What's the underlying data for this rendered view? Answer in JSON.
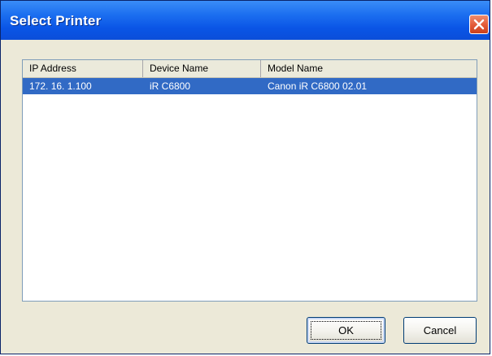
{
  "window": {
    "title": "Select Printer",
    "close_icon": "close-icon"
  },
  "list": {
    "columns": [
      {
        "label": "IP Address"
      },
      {
        "label": "Device Name"
      },
      {
        "label": "Model Name"
      }
    ],
    "rows": [
      {
        "ip": "172. 16.  1.100",
        "device": "iR C6800",
        "model": "Canon iR C6800 02.01",
        "selected": true
      }
    ]
  },
  "buttons": {
    "ok_label": "OK",
    "cancel_label": "Cancel"
  },
  "colors": {
    "titlebar": "#0a55e6",
    "selection": "#316ac5",
    "dialog_bg": "#ece9d8",
    "close_button": "#e25a37"
  }
}
